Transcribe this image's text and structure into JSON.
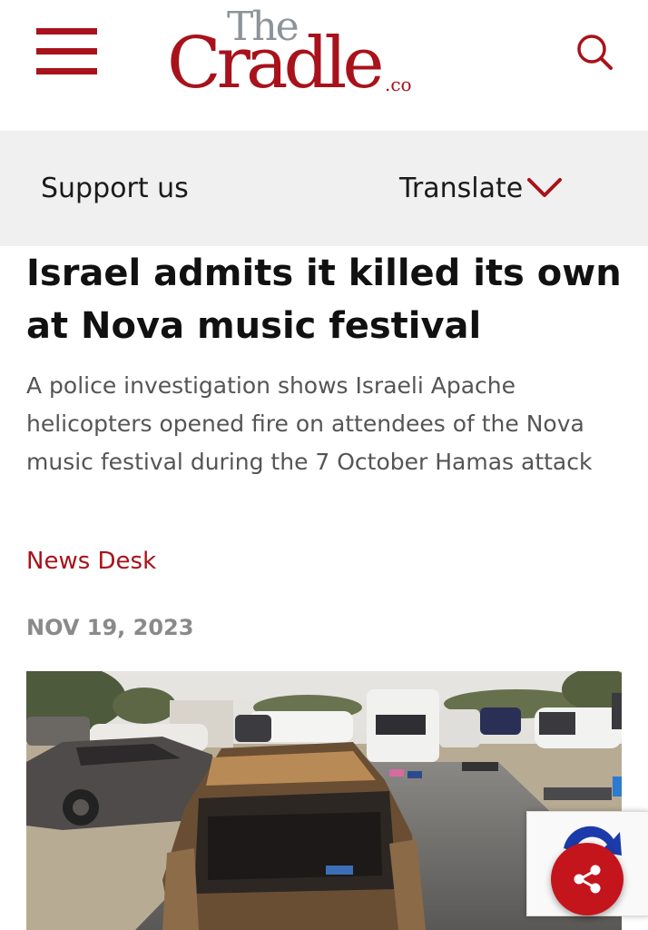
{
  "header": {
    "menu_icon": "hamburger-menu-icon",
    "logo": {
      "line1": "The",
      "line2": "Cradle",
      "suffix": ".co"
    },
    "search_icon": "search-icon",
    "brand_color": "#a8121b"
  },
  "subnav": {
    "support_label": "Support us",
    "translate_label": "Translate",
    "translate_icon": "chevron-down-icon"
  },
  "article": {
    "title": "Israel admits it killed its own at Nova music festival",
    "subtitle": "A police investigation shows Israeli Apache helicopters opened fire on attendees of the Nova music festival during the 7 October Hamas attack",
    "author": "News Desk",
    "date": "NOV 19, 2023",
    "image_icon": "burned-cars-photo"
  },
  "floating": {
    "share_icon": "share-icon",
    "recaptcha_icon": "recaptcha-icon"
  }
}
